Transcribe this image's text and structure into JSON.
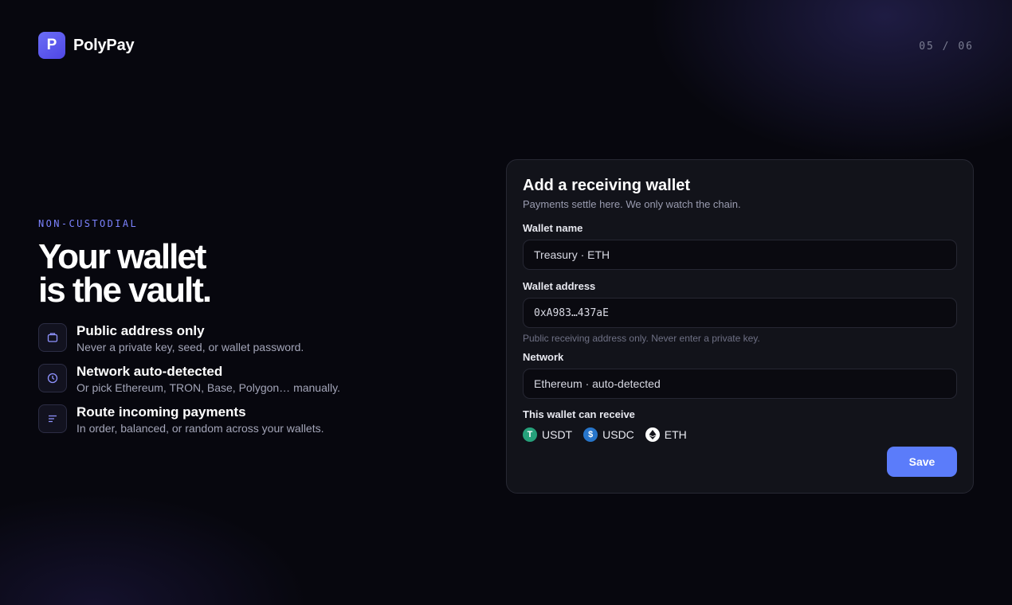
{
  "brand": {
    "logo_letter": "P",
    "name": "PolyPay",
    "logo_color": "#5b5ef0"
  },
  "step": "05 / 06",
  "hero": {
    "eyebrow": "NON-CUSTODIAL",
    "headline_line1": "Your wallet",
    "headline_line2": "is the vault.",
    "features": [
      {
        "icon": "wallet-icon",
        "title": "Public address only",
        "desc": "Never a private key, seed, or wallet password."
      },
      {
        "icon": "clock-icon",
        "title": "Network auto-detected",
        "desc": "Or pick Ethereum, TRON, Base, Polygon… manually."
      },
      {
        "icon": "lines-icon",
        "title": "Route incoming payments",
        "desc": "In order, balanced, or random across your wallets."
      }
    ]
  },
  "form": {
    "title": "Add a receiving wallet",
    "subtitle": "Payments settle here. We only watch the chain.",
    "wallet_name": {
      "label": "Wallet name",
      "value": "Treasury · ETH"
    },
    "wallet_address": {
      "label": "Wallet address",
      "value": "0xA983…437aE",
      "hint": "Public receiving address only. Never enter a private key."
    },
    "network": {
      "label": "Network",
      "value": "Ethereum · auto-detected"
    },
    "receive": {
      "label": "This wallet can receive",
      "tokens": [
        {
          "symbol": "USDT",
          "icon": "tether-icon",
          "color": "#26a17b"
        },
        {
          "symbol": "USDC",
          "icon": "usdc-icon",
          "color": "#2775ca"
        },
        {
          "symbol": "ETH",
          "icon": "ethereum-icon",
          "color": "#ffffff"
        }
      ]
    },
    "save_label": "Save",
    "accent": "#5b7cfa"
  }
}
